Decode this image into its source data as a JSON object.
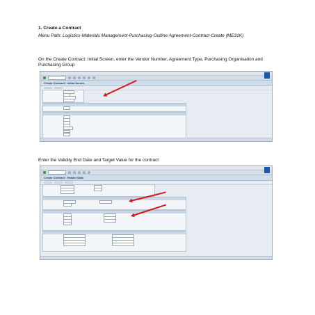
{
  "doc": {
    "title": "1. Create a Contract",
    "menu_path": "Menu Path: Logistics-Materials Management-Purchasing-Outline Agreement-Contract-Create (ME31K)",
    "instruction_1": "On the Create Contract: Initial Screen, enter the Vendor Number, Agreement Type, Purchasing Organisation and Purchasing Group",
    "instruction_2": "Enter the Validity End Date and Target Value for the contract"
  },
  "screen1": {
    "title": "Create Contract : Initial Screen"
  },
  "screen2": {
    "title": "Create Contract : Header Data"
  },
  "colors": {
    "arrow": "#d1171b",
    "sap_blue": "#1b59a8"
  }
}
